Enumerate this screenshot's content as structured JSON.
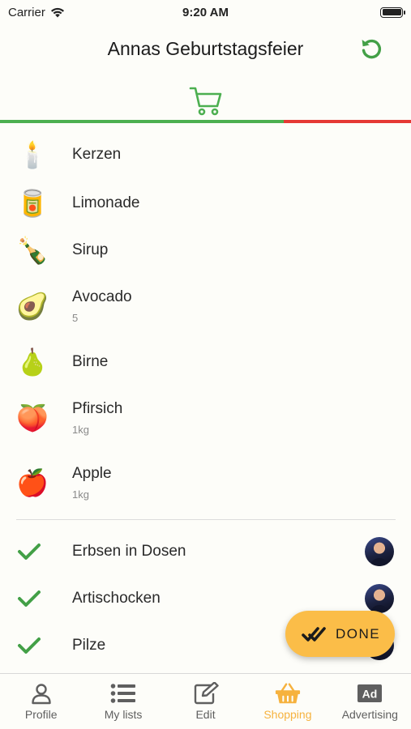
{
  "status_bar": {
    "carrier": "Carrier",
    "time": "9:20 AM"
  },
  "header": {
    "title": "Annas Geburtstagsfeier"
  },
  "progress": {
    "done_fraction": 0.69
  },
  "colors": {
    "green": "#4caf50",
    "red": "#e53935",
    "accent": "#f6b23e",
    "done_button": "#fbbd48"
  },
  "open_items": [
    {
      "icon": "candle-icon",
      "emoji": "🕯️",
      "name": "Kerzen",
      "qty": ""
    },
    {
      "icon": "soda-can-icon",
      "emoji": "🥫",
      "name": "Limonade",
      "qty": ""
    },
    {
      "icon": "syrup-bottle-icon",
      "emoji": "🍾",
      "name": "Sirup",
      "qty": ""
    },
    {
      "icon": "avocado-icon",
      "emoji": "🥑",
      "name": "Avocado",
      "qty": "5"
    },
    {
      "icon": "pear-icon",
      "emoji": "🍐",
      "name": "Birne",
      "qty": ""
    },
    {
      "icon": "peach-icon",
      "emoji": "🍑",
      "name": "Pfirsich",
      "qty": "1kg"
    },
    {
      "icon": "apple-icon",
      "emoji": "🍎",
      "name": "Apple",
      "qty": "1kg"
    }
  ],
  "done_items": [
    {
      "icon": "checkmark-icon",
      "name": "Erbsen in Dosen",
      "avatar": "user-avatar"
    },
    {
      "icon": "checkmark-icon",
      "name": "Artischocken",
      "avatar": "user-avatar"
    },
    {
      "icon": "checkmark-icon",
      "name": "Pilze",
      "avatar": "user-avatar"
    }
  ],
  "done_button": {
    "label": "DONE",
    "icon": "double-check-icon"
  },
  "tabs": [
    {
      "label": "Profile",
      "icon": "person-icon",
      "active": false
    },
    {
      "label": "My lists",
      "icon": "list-icon",
      "active": false
    },
    {
      "label": "Edit",
      "icon": "edit-icon",
      "active": false
    },
    {
      "label": "Shopping",
      "icon": "basket-icon",
      "active": true
    },
    {
      "label": "Advertising",
      "icon": "ad-icon",
      "active": false
    }
  ]
}
